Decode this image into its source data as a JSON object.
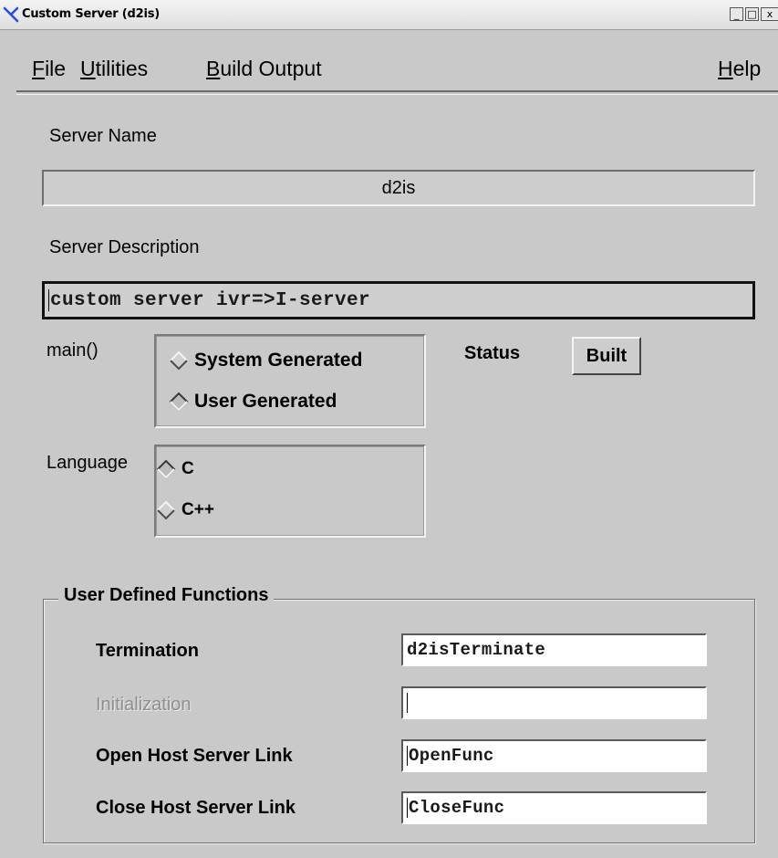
{
  "window": {
    "title": "Custom Server (d2is)",
    "minimize_label": "_",
    "maximize_label": "□",
    "close_label": "x"
  },
  "menu": {
    "file": "File",
    "utilities": "Utilities",
    "build_output": "Build Output",
    "help": "Help"
  },
  "server_name": {
    "label": "Server Name",
    "value": "d2is"
  },
  "server_description": {
    "label": "Server Description",
    "value": "custom server ivr=>I-server"
  },
  "main_section": {
    "label": "main()",
    "options": [
      "System Generated",
      "User Generated"
    ],
    "selected": "User Generated"
  },
  "status": {
    "label": "Status",
    "value": "Built"
  },
  "language_section": {
    "label": "Language",
    "options": [
      "C",
      "C++"
    ],
    "selected": "C"
  },
  "user_defined_functions": {
    "title": "User Defined Functions",
    "rows": [
      {
        "label": "Termination",
        "value": "d2isTerminate",
        "enabled": true
      },
      {
        "label": "Initialization",
        "value": "",
        "enabled": false
      },
      {
        "label": "Open Host Server Link",
        "value": "OpenFunc",
        "enabled": true
      },
      {
        "label": "Close Host Server Link",
        "value": "CloseFunc",
        "enabled": true
      }
    ]
  },
  "colors": {
    "background": "#c9c9c9",
    "input_background": "#ffffff",
    "disabled_text": "#8f8f8f",
    "app_icon": "#2a4fd6"
  }
}
